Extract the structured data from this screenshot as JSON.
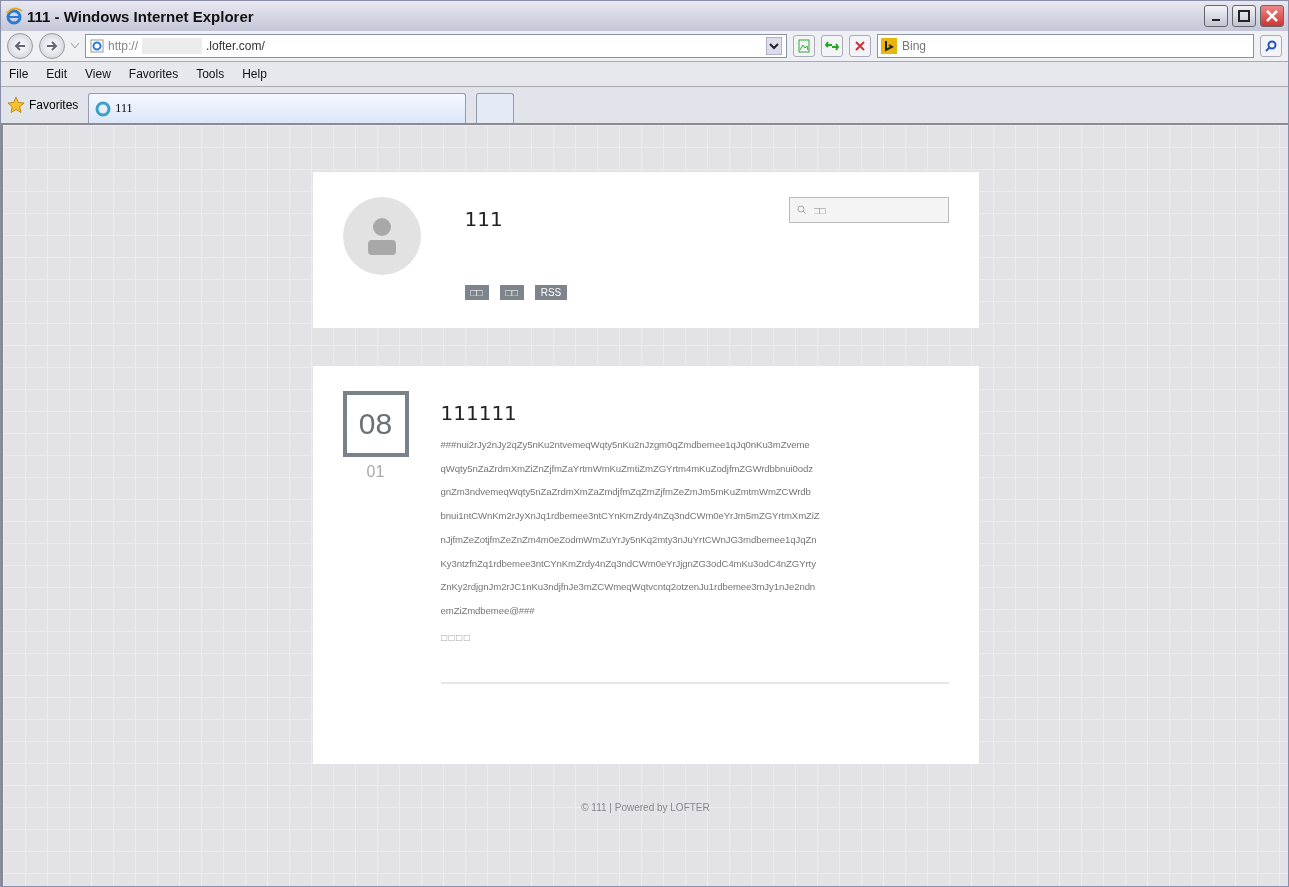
{
  "window": {
    "title": "111 - Windows Internet Explorer"
  },
  "address_bar": {
    "url_prefix": "http://",
    "url_suffix": ".lofter.com/"
  },
  "search": {
    "placeholder": "Bing"
  },
  "menu": [
    "File",
    "Edit",
    "View",
    "Favorites",
    "Tools",
    "Help"
  ],
  "favorites_bar": {
    "label": "Favorites",
    "tabs": [
      {
        "label": "111",
        "selected": true
      }
    ]
  },
  "profile": {
    "name": "111",
    "search_placeholder": "□□",
    "links": [
      "□□",
      "□□",
      "RSS"
    ]
  },
  "post": {
    "day": "08",
    "month": "01",
    "title": "111111",
    "body_lines": [
      "###nui2rJy2nJy2qZy5nKu2ntvemeqWqty5nKu2nJzgm0qZmdbemee1qJq0nKu3mZveme",
      "qWqty5nZaZrdmXmZiZnZjfmZaYrtmWmKuZmtiZmZGYrtm4mKuZodjfmZGWrdbbnui0odz",
      "gnZm3ndvemeqWqty5nZaZrdmXmZaZmdjfmZqZmZjfmZeZmJm5mKuZmtmWmZCWrdb",
      "bnui1ntCWnKm2rJyXnJq1rdbemee3ntCYnKmZrdy4nZq3ndCWm0eYrJm5mZGYrtmXmZiZ",
      "nJjfmZeZotjfmZeZnZm4m0eZodmWmZuYrJy5nKq2mty3nJuYrtCWnJG3mdbemee1qJqZn",
      "Ky3ntzfnZq1rdbemee3ntCYnKmZrdy4nZq3ndCWm0eYrJjgnZG3odC4mKu3odC4nZGYrty",
      "ZnKy2rdjgnJm2rJC1nKu3ndjfnJe3mZCWmeqWqtvcntq2otzenJu1rdbemee3mJy1nJe2ndn",
      "emZiZmdbemee@###"
    ],
    "tags": "□□□□"
  },
  "footer": "© 111 | Powered by LOFTER"
}
